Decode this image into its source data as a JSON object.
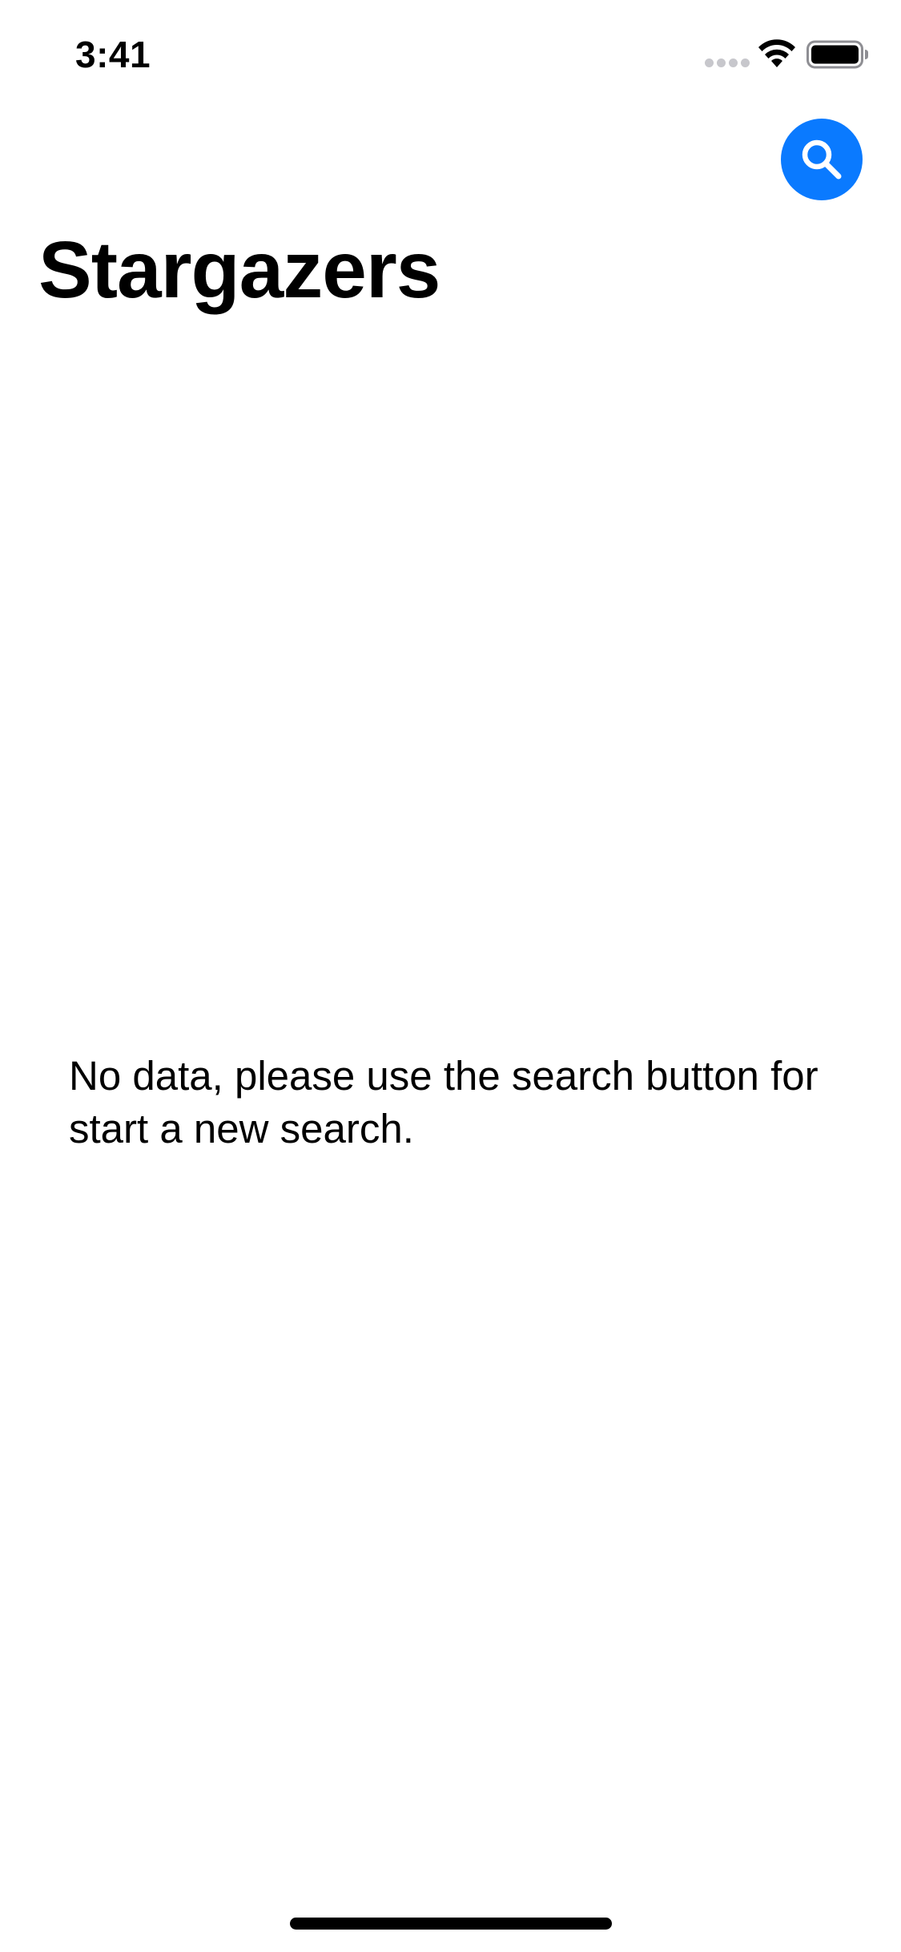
{
  "status_bar": {
    "time": "3:41"
  },
  "header": {
    "title": "Stargazers",
    "search_button_icon": "search-icon",
    "accent_color": "#0a7aff"
  },
  "main": {
    "empty_message": "No data, please use the search button for start a new search."
  }
}
